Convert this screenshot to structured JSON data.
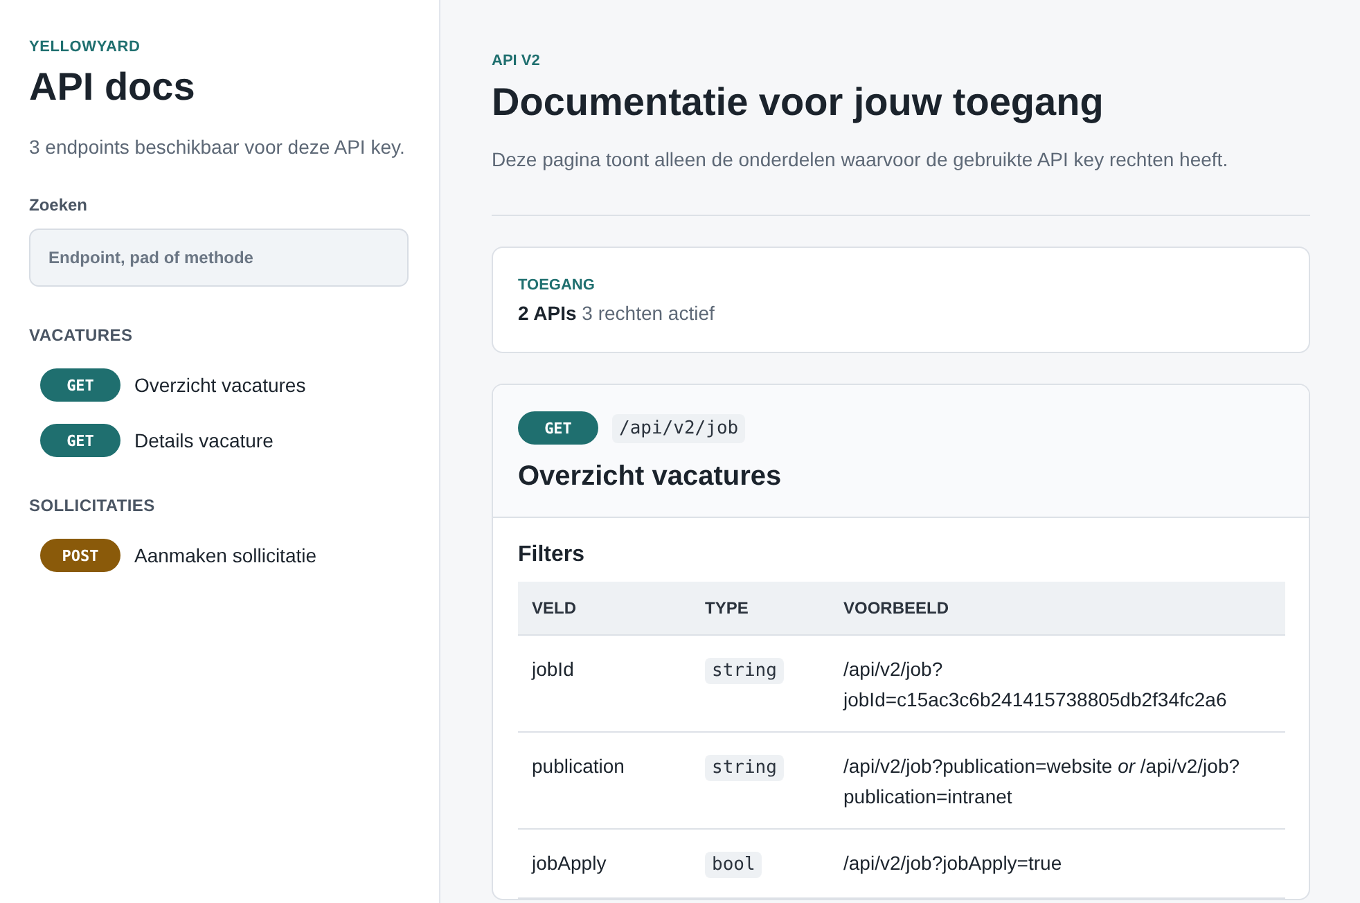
{
  "sidebar": {
    "brand": "YELLOWYARD",
    "title": "API docs",
    "description": "3 endpoints beschikbaar voor deze API key.",
    "search": {
      "label": "Zoeken",
      "placeholder": "Endpoint, pad of methode"
    },
    "groups": [
      {
        "title": "VACATURES",
        "items": [
          {
            "method": "GET",
            "color": "#1f6f6f",
            "label": "Overzicht vacatures"
          },
          {
            "method": "GET",
            "color": "#1f6f6f",
            "label": "Details vacature"
          }
        ]
      },
      {
        "title": "SOLLICITATIES",
        "items": [
          {
            "method": "POST",
            "color": "#8a5a0a",
            "label": "Aanmaken sollicitatie"
          }
        ]
      }
    ]
  },
  "main": {
    "eyebrow": "API V2",
    "title": "Documentatie voor jouw toegang",
    "description": "Deze pagina toont alleen de onderdelen waarvoor de gebruikte API key rechten heeft.",
    "access": {
      "label": "TOEGANG",
      "count": "2 APIs",
      "detail": "3 rechten actief"
    },
    "endpoint": {
      "method": "GET",
      "color": "#1f6f6f",
      "path": "/api/v2/job",
      "title": "Overzicht vacatures",
      "section": "Filters",
      "columns": [
        "VELD",
        "TYPE",
        "VOORBEELD"
      ],
      "rows": [
        {
          "field": "jobId",
          "type": "string",
          "example": "/api/v2/job?jobId=c15ac3c6b241415738805db2f34fc2a6"
        },
        {
          "field": "publication",
          "type": "string",
          "example": "/api/v2/job?publication=website *or* /api/v2/job?publication=intranet"
        },
        {
          "field": "jobApply",
          "type": "bool",
          "example": "/api/v2/job?jobApply=true"
        }
      ]
    }
  }
}
